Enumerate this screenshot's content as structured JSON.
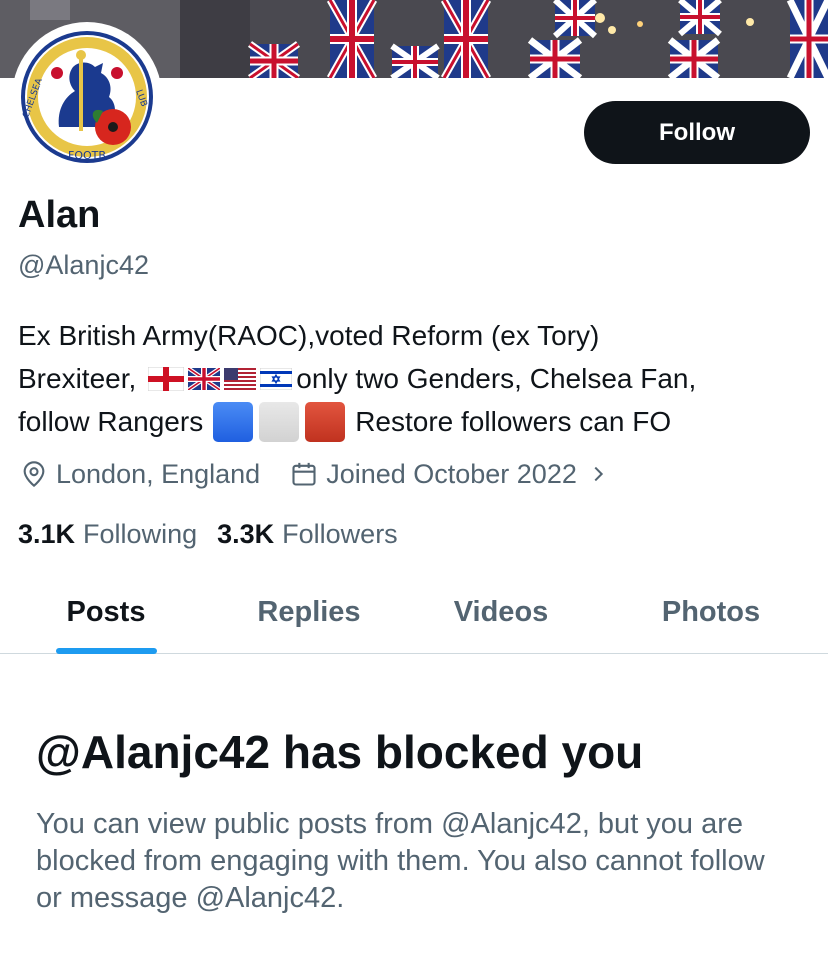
{
  "profile": {
    "display_name": "Alan",
    "handle": "@Alanjc42",
    "follow_label": "Follow",
    "bio": {
      "line1": "Ex British Army(RAOC),voted Reform (ex Tory)",
      "line2_prefix": "Brexiteer,",
      "line2_flags": [
        "england-flag",
        "uk-flag",
        "us-flag",
        "israel-flag"
      ],
      "line2_suffix": "only two Genders, Chelsea Fan,",
      "line3_prefix": "follow Rangers",
      "line3_squares": [
        "blue-square",
        "white-square",
        "red-square"
      ],
      "line3_suffix": "Restore followers can FO"
    },
    "location": "London, England",
    "joined": "Joined October 2022",
    "following_count": "3.1K",
    "following_label": "Following",
    "followers_count": "3.3K",
    "followers_label": "Followers"
  },
  "tabs": [
    {
      "label": "Posts",
      "active": true
    },
    {
      "label": "Replies",
      "active": false
    },
    {
      "label": "Videos",
      "active": false
    },
    {
      "label": "Photos",
      "active": false
    }
  ],
  "blocked": {
    "title": "@Alanjc42 has blocked you",
    "body": "You can view public posts from @Alanjc42, but you are blocked from engaging with them. You also cannot follow or message @Alanjc42."
  },
  "avatar": {
    "text_left": "CHELSEA",
    "text_bottom": "FOOTB",
    "text_right": "LUB"
  },
  "colors": {
    "accent": "#1d9bf0",
    "text_primary": "#0f1419",
    "text_secondary": "#536471",
    "button_bg": "#0f1419"
  }
}
